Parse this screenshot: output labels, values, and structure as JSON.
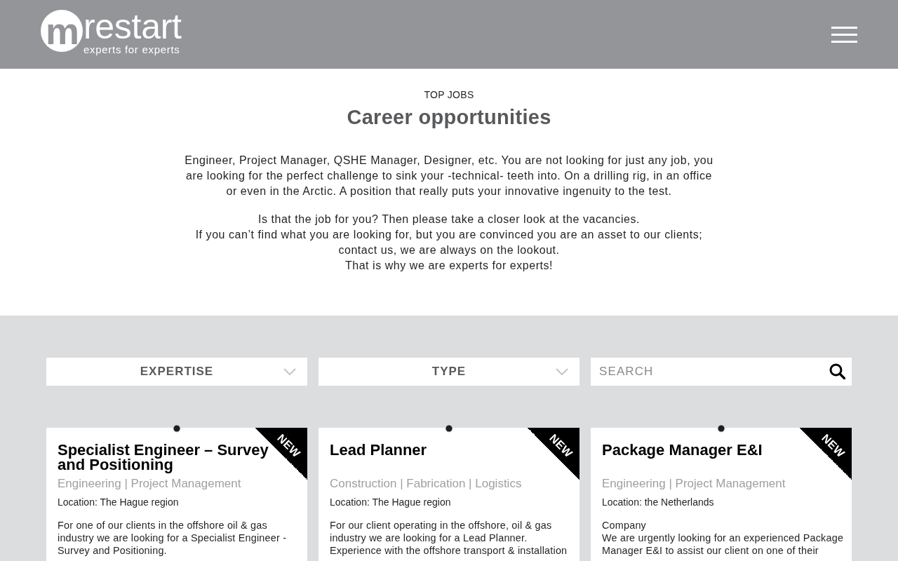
{
  "header": {
    "logo": {
      "mark": "m",
      "name": "restart",
      "tagline": "experts for experts"
    }
  },
  "intro": {
    "eyebrow": "TOP JOBS",
    "title": "Career opportunities",
    "paragraphs": [
      "Engineer, Project Manager, QSHE Manager, Designer, etc. You are not looking for just any job, you are looking for the perfect challenge to sink your -technical- teeth into. On a drilling rig, in an office or even in the Arctic. A position that really puts your innovative ingenuity to the test.",
      "Is that the job for you? Then please take a closer look at the vacancies.\nIf you can’t find what you are looking for, but you are convinced you are an asset to our clients;\ncontact us, we are always on the lookout.\nThat is why we are experts for experts!"
    ]
  },
  "filters": [
    {
      "kind": "dropdown",
      "label": "EXPERTISE"
    },
    {
      "kind": "dropdown",
      "label": "TYPE"
    },
    {
      "kind": "search",
      "placeholder": "SEARCH"
    }
  ],
  "jobs": [
    {
      "title": "Specialist Engineer – Survey and Positioning",
      "badge": "NEW",
      "categories": "Engineering | Project Management",
      "location": "Location: The Hague region",
      "description": "For one of our clients in the offshore oil & gas industry we are looking for a Specialist Engineer - Survey and Positioning."
    },
    {
      "title": "Lead Planner",
      "badge": "NEW",
      "categories": "Construction | Fabrication | Logistics",
      "location": "Location: The Hague region",
      "description": "For our client operating in the offshore, oil & gas industry we are looking for a Lead Planner. Experience with the offshore transport & installation"
    },
    {
      "title": "Package Manager E&I",
      "badge": "NEW",
      "categories": "Engineering | Project Management",
      "location": "Location: the Netherlands",
      "description": "Company\nWe are urgently looking for an experienced Package Manager E&I to assist our client on one of their"
    }
  ]
}
